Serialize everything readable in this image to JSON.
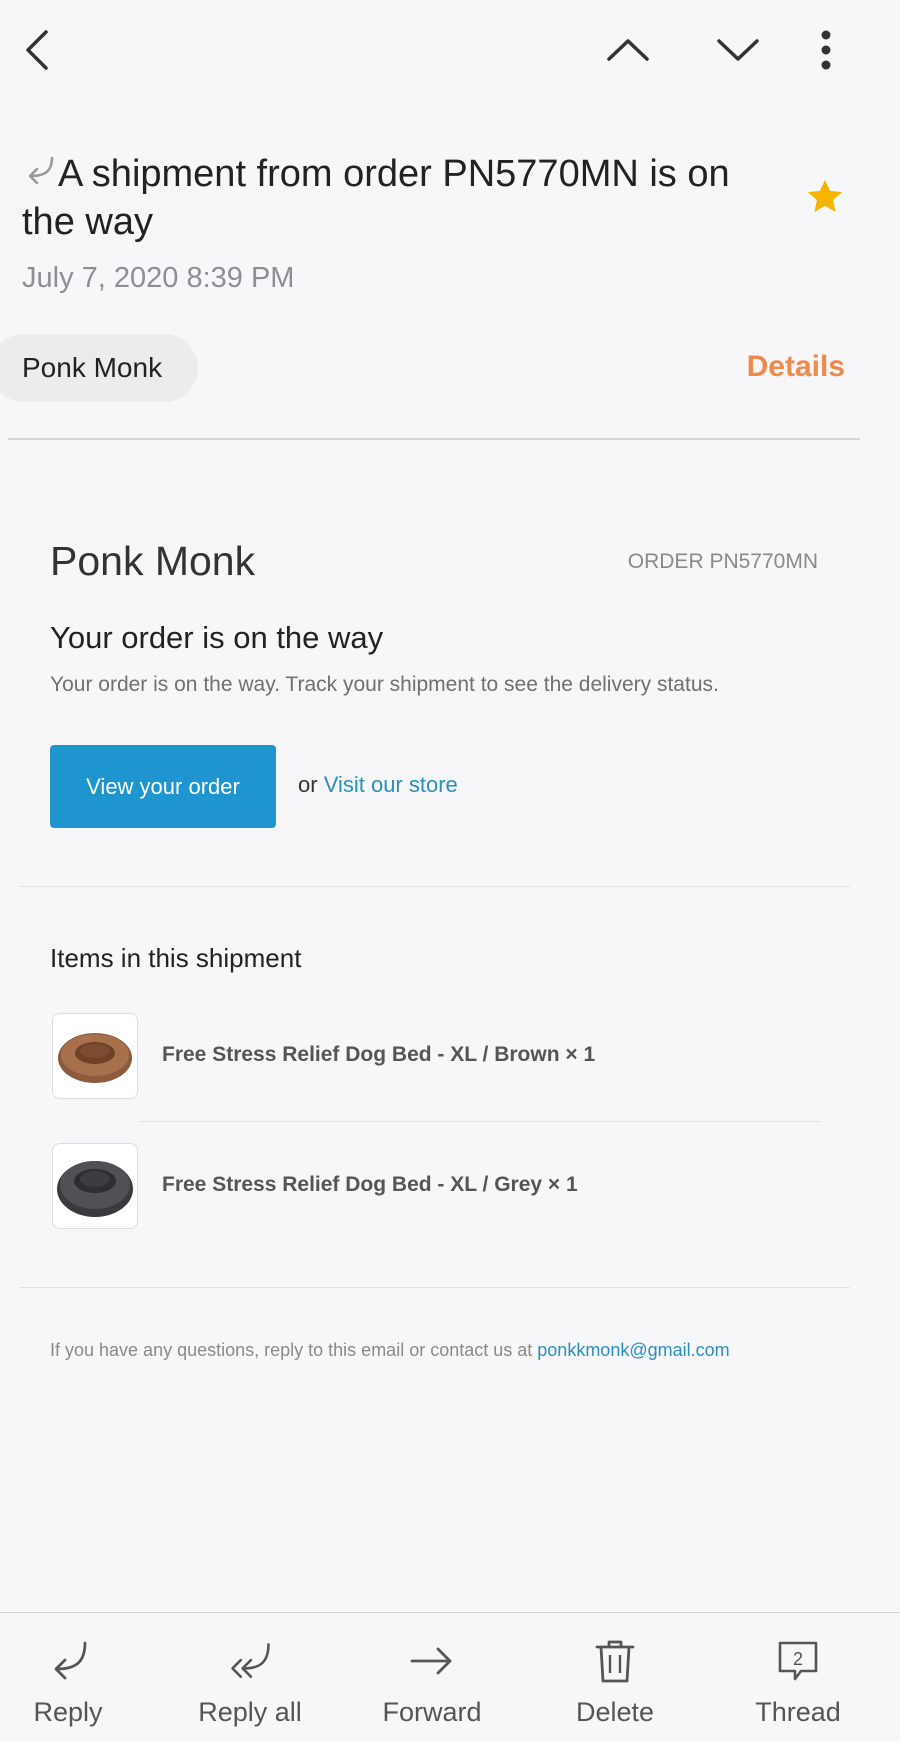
{
  "header": {
    "subject": "A shipment from order PN5770MN is on the way",
    "date": "July 7, 2020  8:39 PM",
    "starred": true,
    "sender": "Ponk Monk",
    "details_label": "Details",
    "icons": [
      "back-arrow-icon",
      "chevron-up-icon",
      "chevron-down-icon",
      "more-vertical-icon",
      "replied-icon",
      "star-icon"
    ]
  },
  "email": {
    "shop_name": "Ponk Monk",
    "order_label": "ORDER PN5770MN",
    "headline": "Your order is on the way",
    "description": "Your order is on the way. Track your shipment to see the delivery status.",
    "cta_label": "View your order",
    "or_text": "or",
    "store_link": "Visit our store",
    "items_title": "Items in this shipment",
    "items": [
      {
        "name": "Free Stress Relief Dog Bed - XL / Brown × 1",
        "image": "brown-dog-bed"
      },
      {
        "name": "Free Stress Relief Dog Bed - XL / Grey × 1",
        "image": "grey-dog-bed"
      }
    ],
    "footer_text": "If you have any questions, reply to this email or contact us at",
    "footer_email": "ponkkmonk@gmail.com"
  },
  "actions": [
    {
      "label": "Reply",
      "icon": "reply-icon"
    },
    {
      "label": "Reply all",
      "icon": "reply-all-icon"
    },
    {
      "label": "Forward",
      "icon": "forward-icon"
    },
    {
      "label": "Delete",
      "icon": "trash-icon"
    },
    {
      "label": "Thread",
      "icon": "thread-icon",
      "badge": "2"
    }
  ],
  "colors": {
    "accent_orange": "#ef8a4c",
    "star_yellow": "#f7b500",
    "cta_blue": "#1e95cf",
    "link_blue": "#2b8fc2",
    "background": "#f7f7f9"
  }
}
